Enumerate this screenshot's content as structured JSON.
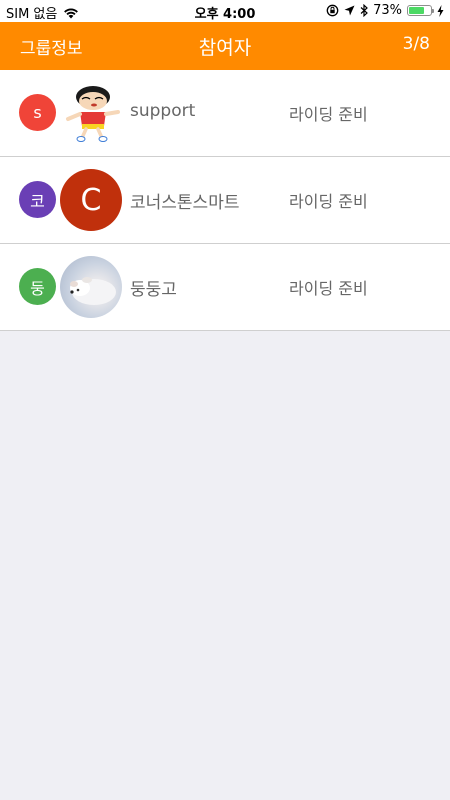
{
  "status_bar": {
    "carrier": "SIM 없음",
    "time": "오후 4:00",
    "battery_percent": "73%",
    "battery_level": 0.73
  },
  "nav": {
    "back_label": "그룹정보",
    "title": "참여자",
    "count": "3/8"
  },
  "participants": [
    {
      "initial": "s",
      "initial_color": "#F04438",
      "avatar": "cartoon-character",
      "name": "support",
      "status": "라이딩 준비"
    },
    {
      "initial": "코",
      "initial_color": "#6A3FB5",
      "avatar_letter": "C",
      "avatar_color": "#C0300C",
      "name": "코너스톤스마트",
      "status": "라이딩 준비"
    },
    {
      "initial": "둥",
      "initial_color": "#4CAF50",
      "avatar": "dog-photo",
      "name": "둥둥고",
      "status": "라이딩 준비"
    }
  ],
  "colors": {
    "nav_background": "#FF8A00",
    "page_background": "#EFEFF4"
  }
}
